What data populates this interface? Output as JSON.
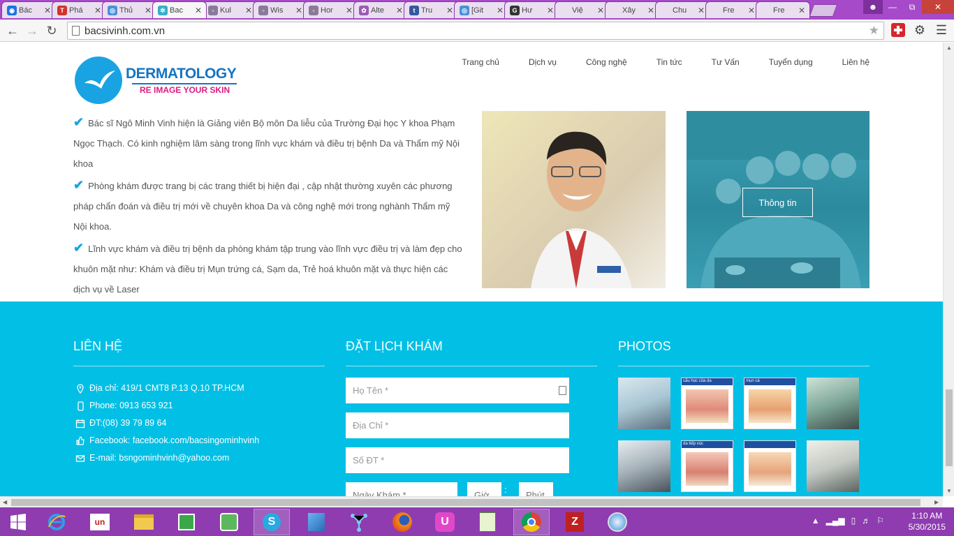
{
  "browser": {
    "tabs": [
      {
        "label": "Bác",
        "color": "#1a73e8",
        "glyph": "◉"
      },
      {
        "label": "Phá",
        "color": "#d0342c",
        "glyph": "T"
      },
      {
        "label": "Thủ",
        "color": "#4a90d9",
        "glyph": "◎"
      },
      {
        "label": "Bac",
        "color": "#35b0c9",
        "glyph": "✲",
        "active": true
      },
      {
        "label": "Kul",
        "color": "#8a7a9a",
        "glyph": "▫"
      },
      {
        "label": "Wis",
        "color": "#8a7a9a",
        "glyph": "▫"
      },
      {
        "label": "Hor",
        "color": "#8a7a9a",
        "glyph": "▫"
      },
      {
        "label": "Alte",
        "color": "#9b59b6",
        "glyph": "✿"
      },
      {
        "label": "Tru",
        "color": "#35579e",
        "glyph": "t"
      },
      {
        "label": "[Git",
        "color": "#4a90d9",
        "glyph": "◎"
      },
      {
        "label": "Hư",
        "color": "#333333",
        "glyph": "G"
      },
      {
        "label": "Việ",
        "color": "#eadff0",
        "glyph": ""
      },
      {
        "label": "Xây",
        "color": "#eadff0",
        "glyph": ""
      },
      {
        "label": "Chu",
        "color": "#eadff0",
        "glyph": ""
      },
      {
        "label": "Fre",
        "color": "#eadff0",
        "glyph": ""
      },
      {
        "label": "Fre",
        "color": "#eadff0",
        "glyph": ""
      }
    ],
    "url": "bacsivinh.com.vn"
  },
  "site": {
    "logo_word": "DERMATOLOGY",
    "logo_tagline": "RE IMAGE YOUR SKIN",
    "nav": [
      "Trang chủ",
      "Dịch vụ",
      "Công nghệ",
      "Tin tức",
      "Tư Vấn",
      "Tuyển dụng",
      "Liên hệ"
    ],
    "bio": [
      "Bác sĩ Ngô Minh Vinh hiện là Giảng viên Bộ môn Da liễu của Trường Đại học Y khoa Phạm Ngọc Thạch. Có kinh nghiệm lâm sàng trong lĩnh vực khám và điều trị bệnh Da và Thẩm mỹ Nội khoa",
      "Phòng khám được trang bị các trang thiết bị hiện đại , cập nhật thường xuyên các phương pháp chẩn đoán và điều trị mới về chuyên khoa Da và công nghệ mới trong nghành Thẩm mỹ Nội khoa.",
      "Lĩnh vực khám và điều trị bệnh da phòng khám tập trung vào lĩnh vực điều trị và làm đẹp cho khuôn mặt như: Khám và điều trị Mụn trứng cá, Sạm da, Trẻ hoá khuôn mặt và thực hiện các dịch vụ về Laser"
    ],
    "info_button": "Thông tin"
  },
  "footer": {
    "contact_title": "LIÊN HỆ",
    "booking_title": "ĐẶT LỊCH KHÁM",
    "photos_title": "PHOTOS",
    "contact": {
      "address": "Địa chỉ: 419/1 CMT8 P.13 Q.10 TP.HCM",
      "phone": "Phone: 0913 653 921",
      "tel": "ĐT:(08) 39 79 89 64",
      "facebook": "Facebook: facebook.com/bacsingominhvinh",
      "email": "E-mail: bsngominhvinh@yahoo.com"
    },
    "form": {
      "name_placeholder": "Họ Tên *",
      "address_placeholder": "Địa Chỉ *",
      "phone_placeholder": "Số ĐT *",
      "date_placeholder": "Ngày Khám *",
      "hour_placeholder": "Giờ",
      "separator": ":",
      "minute_placeholder": "Phút"
    },
    "photo_captions": [
      "",
      "cấu học của da",
      "mụn cá",
      "",
      "",
      "da tiếp xúc",
      "",
      ""
    ]
  },
  "taskbar": {
    "time": "1:10 AM",
    "date": "5/30/2015"
  },
  "colors": {
    "tabstrip": "#a64ac9",
    "footer": "#02bfe5",
    "brand_blue": "#1474c4",
    "brand_pink": "#e0197d",
    "taskbar": "#8e3cb0"
  }
}
